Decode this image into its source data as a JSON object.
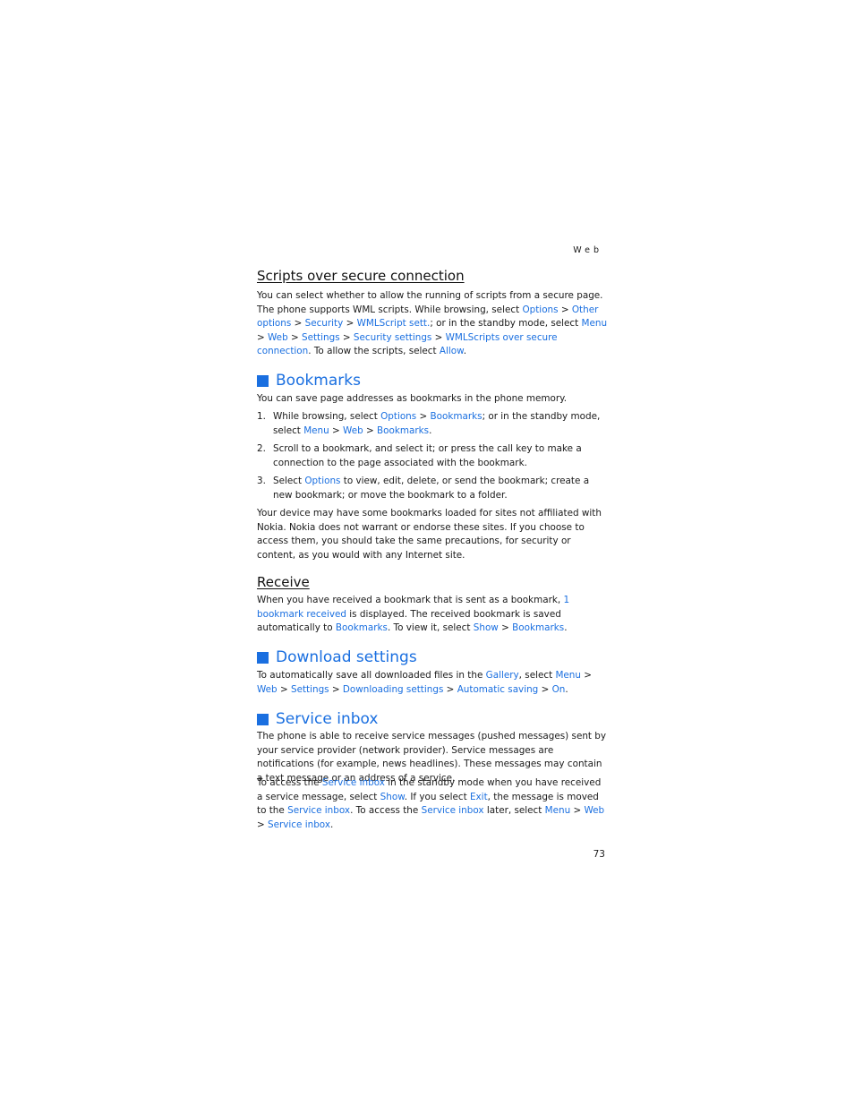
{
  "running_head": "Web",
  "page_number": "73",
  "colors": {
    "link": "#1a6fe0",
    "heading": "#1a6fe0",
    "text": "#1a1a1a"
  },
  "scripts_section": {
    "heading": "Scripts over secure connection",
    "p1": "You can select whether to allow the running of scripts from a secure page. The phone supports WML scripts. While browsing, select ",
    "l_options": "Options",
    "gt": " > ",
    "l_other": "Other options",
    "l_security": "Security",
    "l_wmlsett": "WMLScript sett.",
    "p2": "; or in the standby mode, select ",
    "l_menu": "Menu",
    "l_web": "Web",
    "l_settings": "Settings",
    "l_secset": "Security settings",
    "l_wmlsecure": "WMLScripts over secure connection",
    "p3": ". To allow the scripts, select ",
    "l_allow": "Allow",
    "end": "."
  },
  "bookmarks_section": {
    "heading": "Bookmarks",
    "intro": "You can save page addresses as bookmarks in the phone memory.",
    "steps": [
      {
        "num": "1.",
        "a": "While browsing, select ",
        "l1": "Options",
        "gt": " > ",
        "l2": "Bookmarks",
        "b": "; or in the standby mode, select ",
        "l3": "Menu",
        "l4": "Web",
        "l5": "Bookmarks",
        "end": "."
      },
      {
        "num": "2.",
        "text": "Scroll to a bookmark, and select it; or press the call key to make a connection to the page associated with the bookmark."
      },
      {
        "num": "3.",
        "a": "Select ",
        "l1": "Options",
        "b": " to view, edit, delete, or send the bookmark; create a new bookmark; or move the bookmark to a folder."
      }
    ],
    "disclaimer": "Your device may have some bookmarks loaded for sites not affiliated with Nokia. Nokia does not warrant or endorse these sites. If you choose to access them, you should take the same precautions, for security or content, as you would with any Internet site."
  },
  "receive_section": {
    "heading": "Receive",
    "a": "When you have received a bookmark that is sent as a bookmark, ",
    "l1": "1 bookmark received",
    "b": " is displayed. The received bookmark is saved automatically to ",
    "l2": "Bookmarks",
    "c": ". To view it, select ",
    "l3": "Show",
    "gt": " > ",
    "l4": "Bookmarks",
    "end": "."
  },
  "download_section": {
    "heading": "Download settings",
    "a": "To automatically save all downloaded files in the ",
    "l_gallery": "Gallery",
    "b": ", select ",
    "l_menu": "Menu",
    "gt": " > ",
    "l_web": "Web",
    "l_settings": "Settings",
    "l_dlset": "Downloading settings",
    "l_auto": "Automatic saving",
    "l_on": "On",
    "end": "."
  },
  "service_section": {
    "heading": "Service inbox",
    "p1": "The phone is able to receive service messages (pushed messages) sent by your service provider (network provider). Service messages are notifications (for example, news headlines). These messages may contain a text message or an address of a service.",
    "a": "To access the ",
    "l_inbox": "Service inbox",
    "b": " in the standby mode when you have received a service message, select ",
    "l_show": "Show",
    "c": ". If you select ",
    "l_exit": "Exit",
    "d": ", the message is moved to the ",
    "e": ". To access the ",
    "f": " later, select ",
    "l_menu": "Menu",
    "gt": " > ",
    "l_web": "Web",
    "end": "."
  }
}
